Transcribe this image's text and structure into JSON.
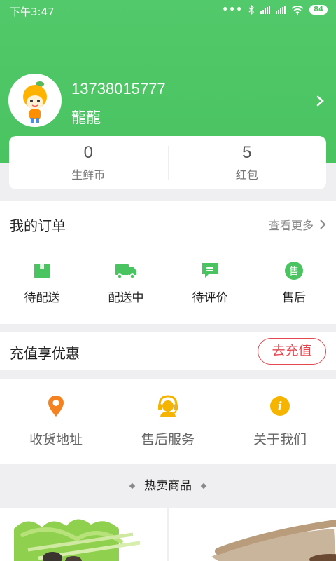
{
  "status_bar": {
    "time": "下午3:47",
    "battery": "84",
    "icons": [
      "signal-icon",
      "bluetooth-icon",
      "hd-signal-icon",
      "wifi-icon",
      "battery-icon"
    ]
  },
  "profile": {
    "phone": "13738015777",
    "name": "龍龍"
  },
  "stats": [
    {
      "value": "0",
      "label": "生鲜币"
    },
    {
      "value": "5",
      "label": "红包"
    }
  ],
  "orders": {
    "title": "我的订单",
    "more": "查看更多",
    "items": [
      {
        "label": "待配送",
        "icon": "box-icon"
      },
      {
        "label": "配送中",
        "icon": "truck-icon"
      },
      {
        "label": "待评价",
        "icon": "comment-icon"
      },
      {
        "label": "售后",
        "icon": "after-sales-icon",
        "glyph": "售"
      }
    ]
  },
  "recharge": {
    "title": "充值享优惠",
    "button": "去充值"
  },
  "services": [
    {
      "label": "收货地址",
      "icon": "location-pin-icon"
    },
    {
      "label": "售后服务",
      "icon": "customer-service-icon"
    },
    {
      "label": "关于我们",
      "icon": "info-icon",
      "glyph": "i"
    }
  ],
  "hot": {
    "title": "热卖商品"
  },
  "colors": {
    "brand_green": "#4ac361",
    "accent_red": "#e4474f",
    "orange": "#f58220",
    "gold": "#f5b400"
  }
}
